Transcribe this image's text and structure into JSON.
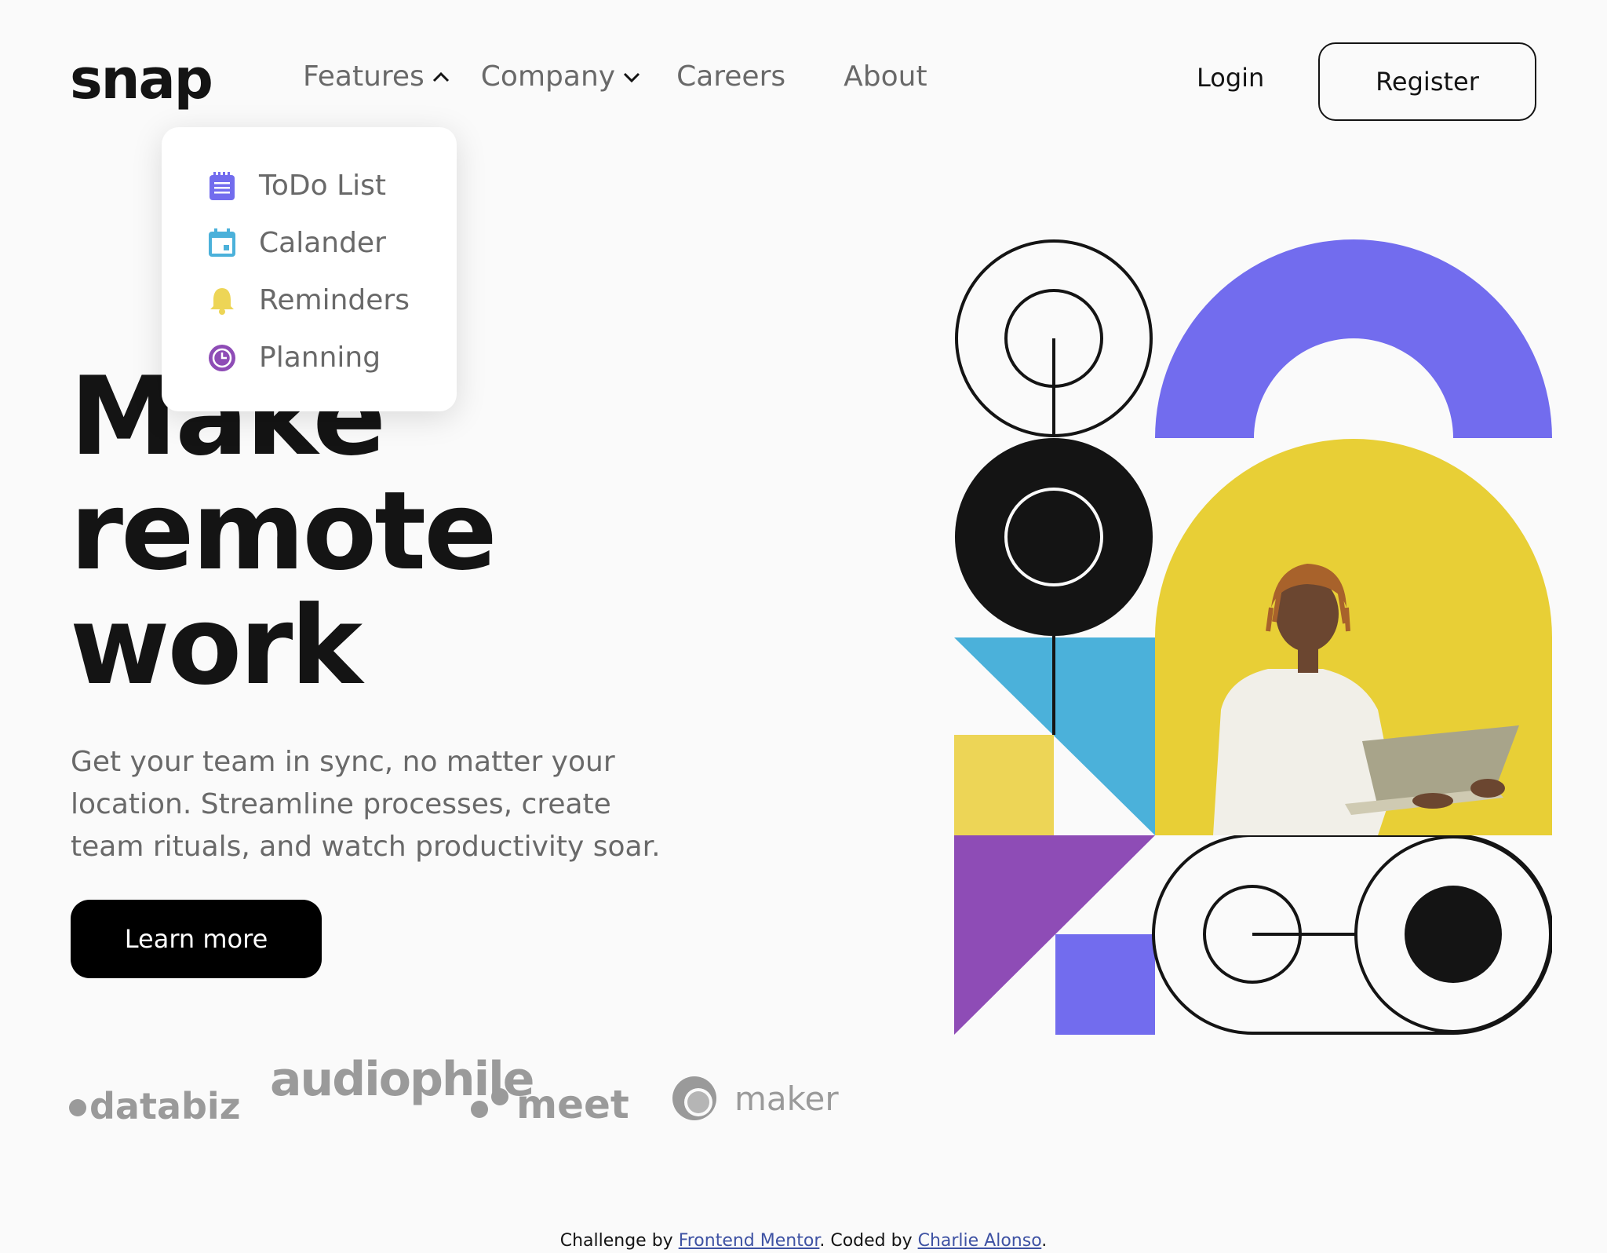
{
  "brand": {
    "logo_text": "snap"
  },
  "nav": {
    "features": "Features",
    "company": "Company",
    "careers": "Careers",
    "about": "About",
    "login": "Login",
    "register": "Register"
  },
  "features_menu": {
    "items": [
      {
        "label": "ToDo List",
        "icon": "todo-list-icon",
        "color": "#726CEE"
      },
      {
        "label": "Calander",
        "icon": "calendar-icon",
        "color": "#4BB1DA"
      },
      {
        "label": "Reminders",
        "icon": "bell-icon",
        "color": "#EDD556"
      },
      {
        "label": "Planning",
        "icon": "clock-icon",
        "color": "#8E4CB6"
      }
    ]
  },
  "hero": {
    "headline_lines": [
      "Make",
      "remote",
      "work"
    ],
    "subtext": "Get your team in sync, no matter your location. Streamline processes, create team rituals, and watch productivity soar.",
    "cta": "Learn more"
  },
  "clients": [
    "databiz",
    "audiophile",
    "meet",
    "maker"
  ],
  "illustration": {
    "description_colors": {
      "purple": "#726CEE",
      "yellow": "#EDD556",
      "blue": "#4BB1DA",
      "violet": "#8E4CB6",
      "black": "#141414"
    }
  },
  "footer": {
    "prefix": "Challenge by ",
    "link1": "Frontend Mentor",
    "middle": ". Coded by ",
    "link2": "Charlie Alonso",
    "suffix": "."
  }
}
